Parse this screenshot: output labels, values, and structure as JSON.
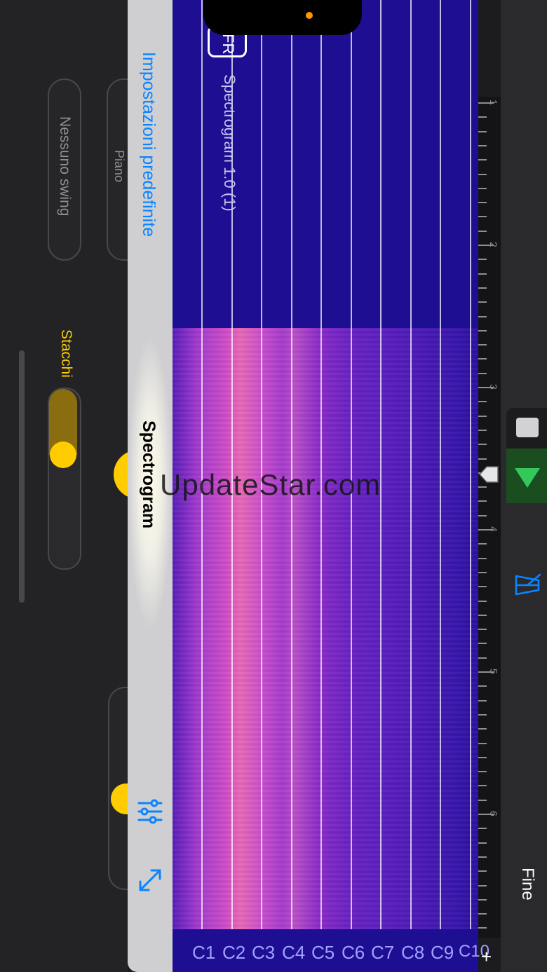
{
  "watermark": "UpdateStar.com",
  "background_app": {
    "swing_label": "Nessuno swing",
    "instrument_label": "Piano",
    "staccati_label": "Stacchi"
  },
  "plugin_panel": {
    "presets_label": "Impostazioni predefinite",
    "title": "Spectrogram",
    "badge": "FR",
    "preset_name": "Spectrogram 1.0 (1)",
    "settings_icon": "sliders-icon",
    "expand_icon": "expand-arrows-icon"
  },
  "spectrogram": {
    "note_labels": [
      "C1",
      "C2",
      "C3",
      "C4",
      "C5",
      "C6",
      "C7",
      "C8",
      "C9",
      "C10"
    ],
    "colors": {
      "background": "#1e0e92",
      "hot": "#e86ab6",
      "mid": "#a23ad0"
    }
  },
  "timeline": {
    "bars": [
      "1",
      "2",
      "3",
      "4",
      "5",
      "6"
    ]
  },
  "transport": {
    "stop_icon": "stop-icon",
    "play_icon": "play-icon",
    "metronome_icon": "metronome-icon",
    "done_label": "Fine",
    "add_icon": "plus-icon",
    "add_label": "+",
    "colors": {
      "play": "#34c759",
      "accent": "#0a84ff"
    }
  }
}
